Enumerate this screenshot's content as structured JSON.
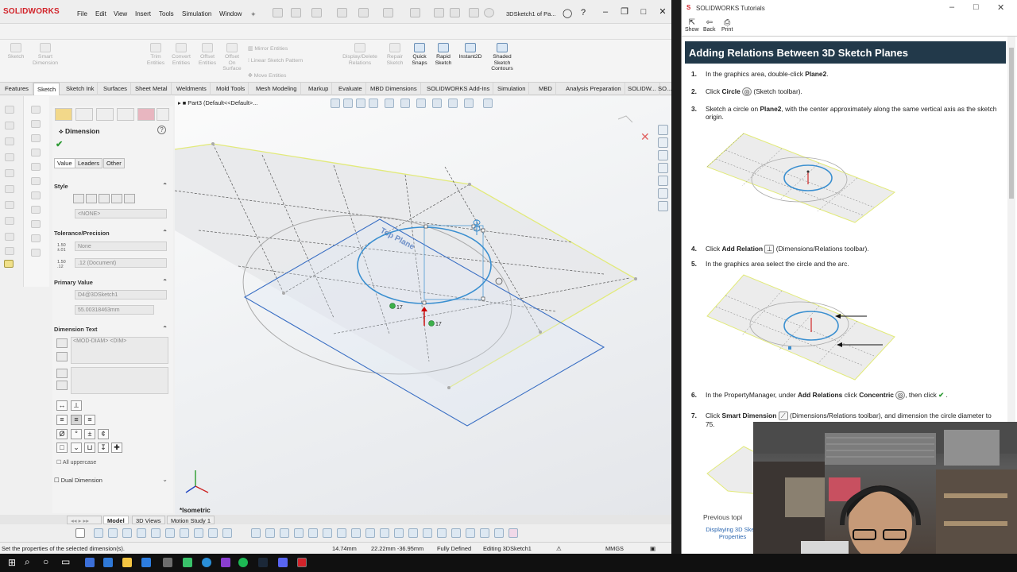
{
  "sw": {
    "logo": "SOLIDWORKS",
    "menu": [
      "File",
      "Edit",
      "View",
      "Insert",
      "Tools",
      "Simulation",
      "Window"
    ],
    "doc_title": "3DSketch1 of Pa...",
    "ribbon": {
      "left_items": [
        "Sketch",
        "Smart Dimension",
        "Trim Entities",
        "Convert Entities",
        "Offset Entities",
        "Offset On Surface"
      ],
      "mirror": "Mirror Entities",
      "linear_pattern": "Linear Sketch Pattern",
      "move": "Move Entities",
      "display_delete": "Display/Delete Relations",
      "repair": "Repair Sketch",
      "quick_snaps": "Quick Snaps",
      "rapid_sketch": "Rapid Sketch",
      "instant2d": "Instant2D",
      "shaded": "Shaded Sketch Contours"
    },
    "tabs": [
      "Features",
      "Sketch",
      "Sketch Ink",
      "Surfaces",
      "Sheet Metal",
      "Weldments",
      "Mold Tools",
      "Mesh Modeling",
      "Markup",
      "Evaluate",
      "MBD Dimensions",
      "SOLIDWORKS Add-Ins",
      "Simulation",
      "MBD",
      "Analysis Preparation",
      "SOLIDW...",
      "SO..."
    ],
    "active_tab": "Sketch",
    "pm": {
      "title": "Dimension",
      "help": "?",
      "subtabs": [
        "Value",
        "Leaders",
        "Other"
      ],
      "style_label": "Style",
      "style_value": "<NONE>",
      "tolerance_label": "Tolerance/Precision",
      "tol_icon": "1.50 ±.01",
      "tol_value": "None",
      "prec_icon": "1.50 .12",
      "prec_value": ".12 (Document)",
      "primary_label": "Primary Value",
      "primary_name": "D4@3DSketch1",
      "primary_value": "55.00318463mm",
      "dimtext_label": "Dimension Text",
      "dimtext_value": "<MOD-DIAM> <DIM>",
      "symbols_row1": [
        "Ø",
        "°",
        "±",
        "¢"
      ],
      "all_upper": "All uppercase",
      "dual_label": "Dual Dimension"
    },
    "gfx": {
      "tree": "Part3  (Default<<Default>...",
      "plane_label": "Top Plane",
      "view_label": "*Isometric",
      "tag1": "17",
      "tag2": "17"
    },
    "model_tabs": [
      "Model",
      "3D Views",
      "Motion Study 1"
    ],
    "status": {
      "message": "Set the properties of the selected dimension(s).",
      "x": "14.74mm",
      "yz": "22.22mm -36.95mm",
      "defined": "Fully Defined",
      "editing": "Editing 3DSketch1",
      "units": "MMGS"
    }
  },
  "tut": {
    "window_title": "SOLIDWORKS Tutorials",
    "toolbar": [
      "Show",
      "Back",
      "Print"
    ],
    "heading": "Adding Relations Between 3D Sketch Planes",
    "steps": [
      {
        "n": "1.",
        "a": "In the graphics area, double-click ",
        "b": "Plane2",
        "c": "."
      },
      {
        "n": "2.",
        "a": "Click ",
        "b": "Circle",
        "c": " (Sketch toolbar)."
      },
      {
        "n": "3.",
        "a": "Sketch a circle on ",
        "b": "Plane2",
        "c": ", with the center approximately along the same vertical axis as the sketch origin."
      },
      {
        "n": "4.",
        "a": "Click ",
        "b": "Add Relation",
        "c": " (Dimensions/Relations toolbar)."
      },
      {
        "n": "5.",
        "a": "In the graphics area select the circle and the arc.",
        "b": "",
        "c": ""
      },
      {
        "n": "6.",
        "a": "In the PropertyManager, under ",
        "b": "Add Relations",
        "c": " click "
      },
      {
        "n": "7.",
        "a": "Click ",
        "b": "Smart Dimension",
        "c": " (Dimensions/Relations toolbar), and dimension the circle diameter to 75."
      }
    ],
    "step6_concentric": "Concentric",
    "step6_then": ", then click",
    "step6_end": ".",
    "prev_label": "Previous topi",
    "prev_link": "Displaying 3D Ske... Properties"
  },
  "colors": {
    "sw_red": "#d2232a",
    "tut_header": "#22394a",
    "plane_blue": "#3a6fc4",
    "circle_blue": "#3a8fd0"
  }
}
